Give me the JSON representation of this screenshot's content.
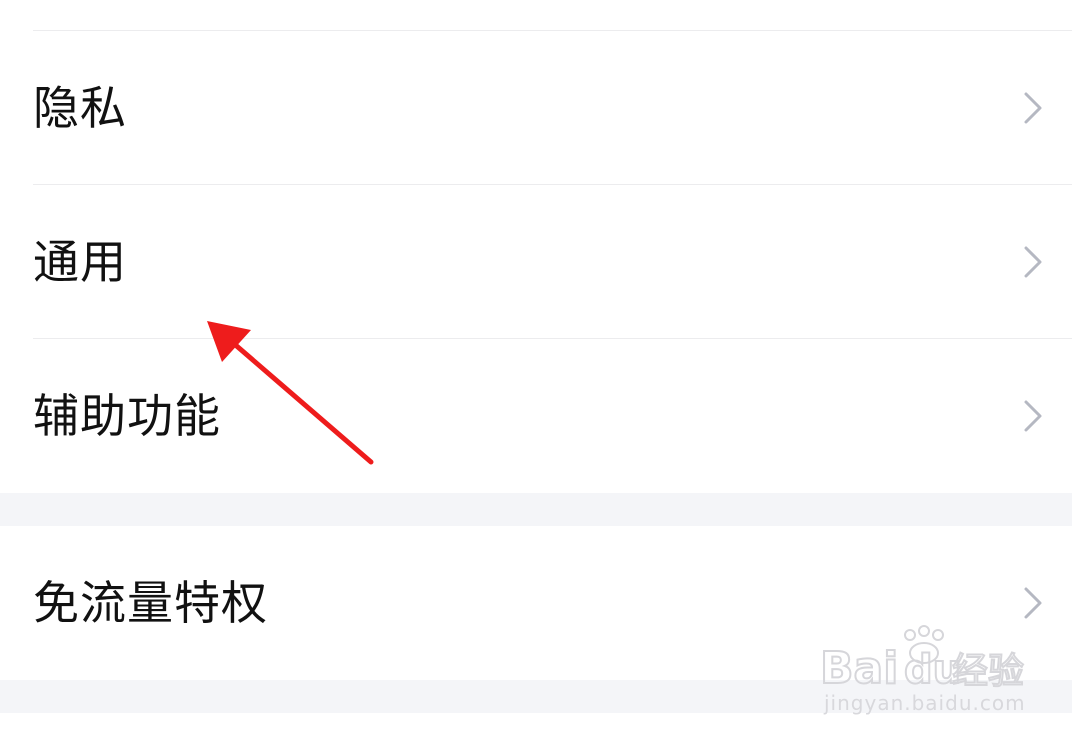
{
  "settings": {
    "items": [
      {
        "label": "隐私"
      },
      {
        "label": "通用"
      },
      {
        "label": "辅助功能"
      },
      {
        "label": "免流量特权"
      }
    ],
    "chevron_icon": "chevron-right-icon",
    "chevron_color": "#b5b8c2",
    "divider_color": "#ececee",
    "section_gap_color": "#f4f5f8"
  },
  "annotation": {
    "arrow_icon": "red-arrow-icon",
    "color": "#ee1c1c"
  },
  "watermark": {
    "brand": "Bai",
    "brand2": "du",
    "suffix": "经验",
    "url": "jingyan.baidu.com"
  }
}
